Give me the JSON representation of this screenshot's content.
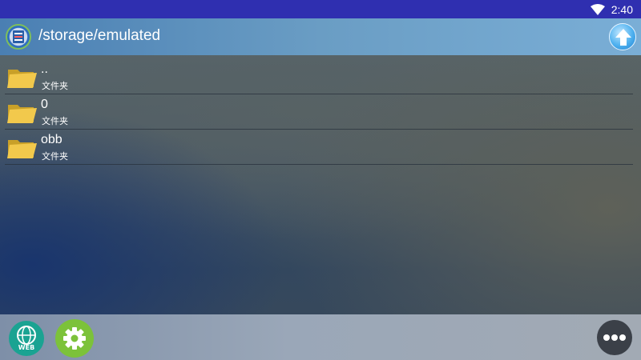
{
  "status_bar": {
    "time": "2:40",
    "wifi_icon": "wifi-icon"
  },
  "header": {
    "app_icon": "file-manager-app-icon",
    "path": "/storage/emulated",
    "up_icon": "arrow-up-icon"
  },
  "files": [
    {
      "name": "..",
      "type": "文件夹",
      "icon": "folder-icon"
    },
    {
      "name": "0",
      "type": "文件夹",
      "icon": "folder-icon"
    },
    {
      "name": "obb",
      "type": "文件夹",
      "icon": "folder-icon"
    }
  ],
  "bottom_bar": {
    "web_label": "WEB",
    "web_icon": "globe-icon",
    "settings_icon": "gear-icon",
    "more_icon": "more-dots-icon"
  },
  "colors": {
    "status_bar": "#2f2fb0",
    "header_start": "#4a7fb3",
    "folder": "#f2c94c",
    "web_button": "#1aa392",
    "settings_button": "#7cc23a",
    "more_button": "#3b4048"
  }
}
